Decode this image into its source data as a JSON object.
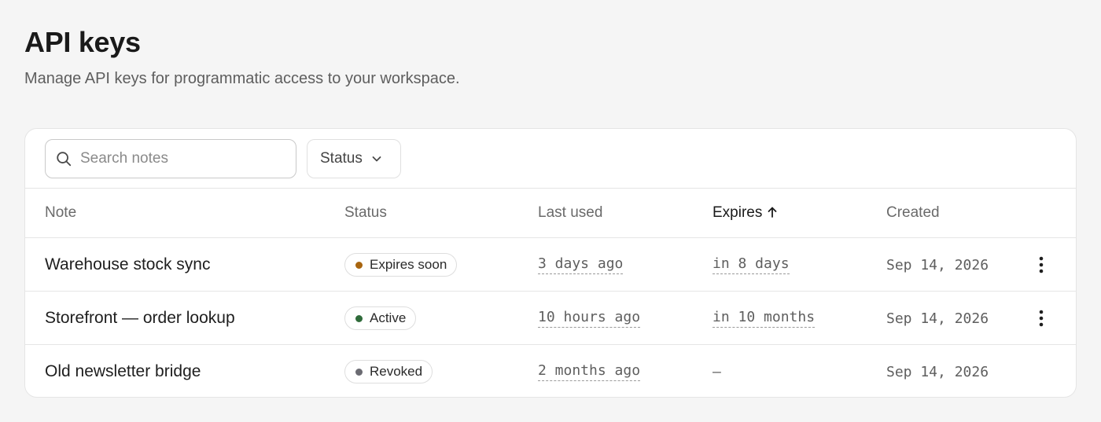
{
  "page": {
    "title": "API keys",
    "subtitle": "Manage API keys for programmatic access to your workspace."
  },
  "toolbar": {
    "search_placeholder": "Search notes",
    "status_filter_label": "Status"
  },
  "table": {
    "columns": {
      "note": "Note",
      "status": "Status",
      "last_used": "Last used",
      "expires": "Expires",
      "created": "Created"
    },
    "sort": {
      "column": "expires",
      "direction": "ascending"
    },
    "rows": [
      {
        "note": "Warehouse stock sync",
        "status": "Expires soon",
        "status_color": "#a8650f",
        "last_used": "3 days ago",
        "expires": "in 8 days",
        "created": "Sep 14, 2026",
        "has_menu": true
      },
      {
        "note": "Storefront — order lookup",
        "status": "Active",
        "status_color": "#2f6b3a",
        "last_used": "10 hours ago",
        "expires": "in 10 months",
        "created": "Sep 14, 2026",
        "has_menu": true
      },
      {
        "note": "Old newsletter bridge",
        "status": "Revoked",
        "status_color": "#6b6b72",
        "last_used": "2 months ago",
        "expires": "—",
        "created": "Sep 14, 2026",
        "has_menu": false
      }
    ]
  },
  "icons": {
    "search": "search-icon",
    "chevron": "chevron-down-icon",
    "sort": "arrow-up-icon",
    "menu": "more-vertical-icon"
  }
}
